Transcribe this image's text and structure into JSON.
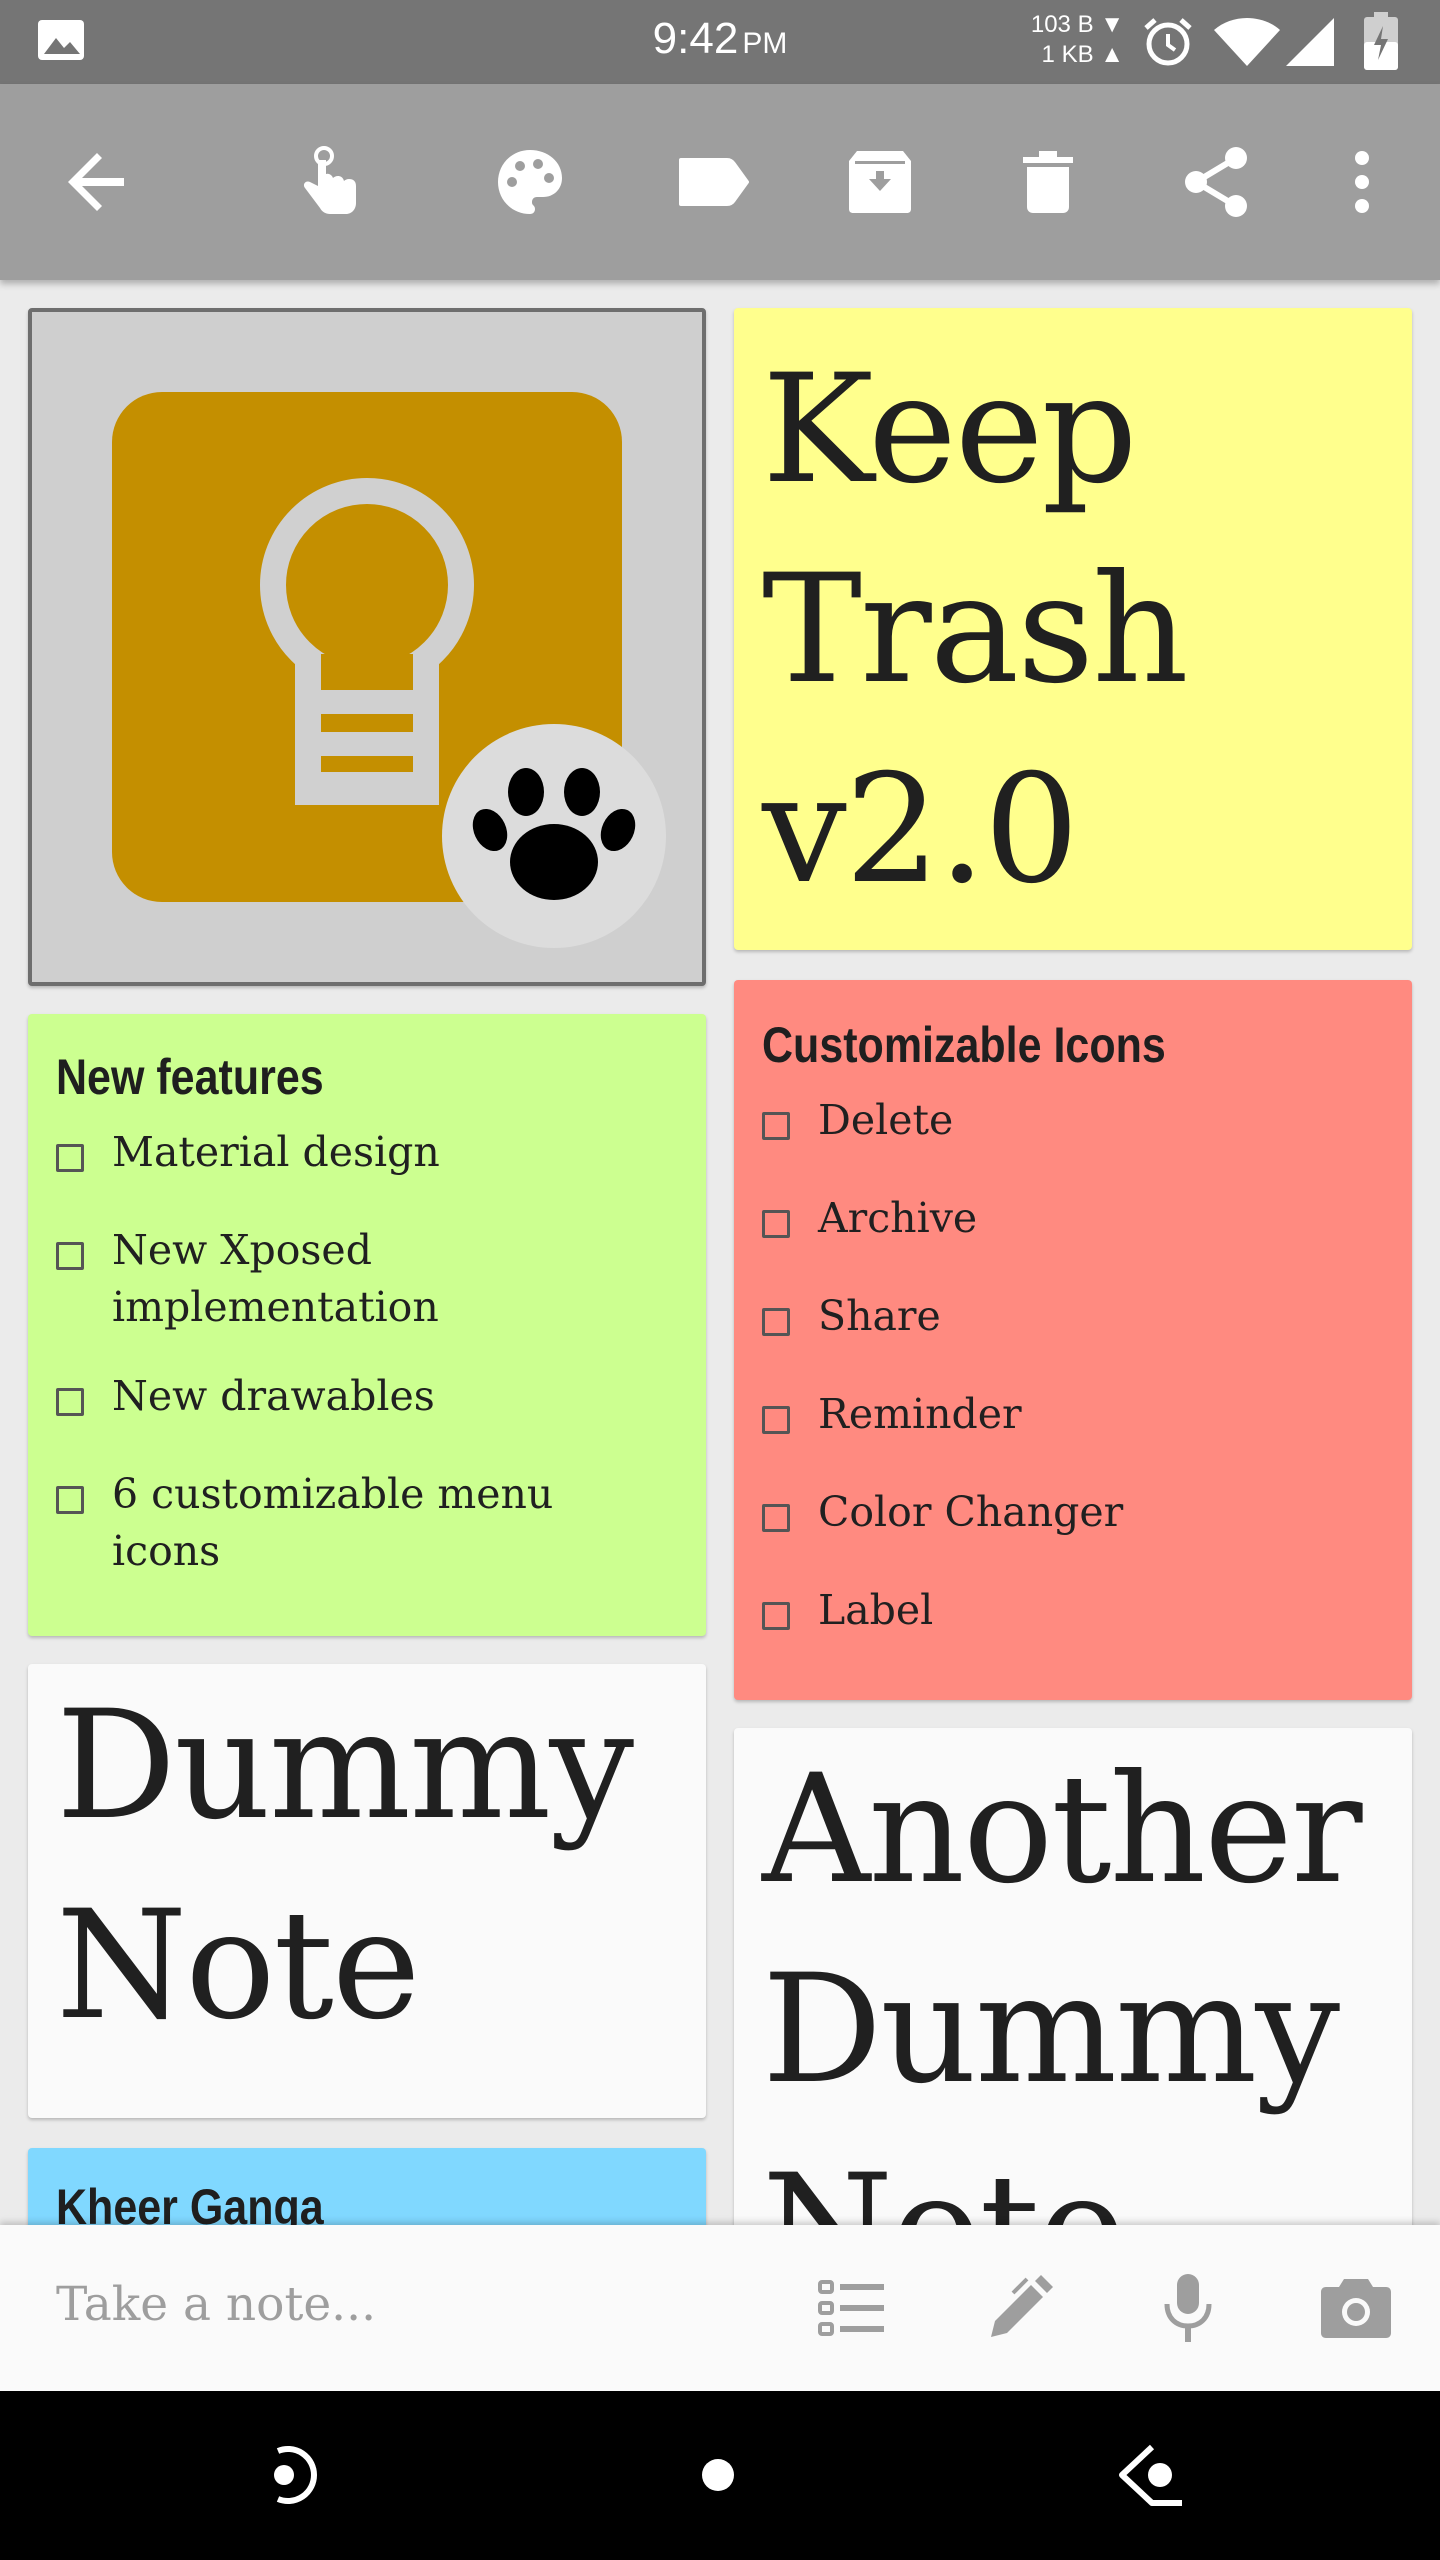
{
  "status_bar": {
    "time": "9:42",
    "ampm": "PM",
    "net_down": "103 B ▼",
    "net_up": "1 KB ▲",
    "icons": [
      "image-icon",
      "alarm-icon",
      "wifi-icon",
      "signal-icon",
      "battery-icon"
    ]
  },
  "toolbar": {
    "buttons": [
      "back-arrow-icon",
      "pin-icon",
      "palette-icon",
      "label-icon",
      "archive-icon",
      "delete-icon",
      "share-icon",
      "more-vert-icon"
    ]
  },
  "notes": {
    "image_note": {
      "icon": "keep-lightbulb-logo",
      "badge": "paw-icon"
    },
    "keep_trash": {
      "lines": [
        "Keep",
        "Trash",
        "v2.0"
      ]
    },
    "new_features": {
      "title": "New features",
      "items": [
        [
          "Material design"
        ],
        [
          "New Xposed",
          "implementation"
        ],
        [
          "New drawables"
        ],
        [
          "6 customizable menu",
          "icons"
        ]
      ]
    },
    "custom_icons": {
      "title": "Customizable Icons",
      "items": [
        "Delete",
        "Archive",
        "Share",
        "Reminder",
        "Color Changer",
        "Label"
      ]
    },
    "dummy_note": {
      "lines": [
        "Dummy",
        "Note"
      ]
    },
    "another_dummy": {
      "lines": [
        "Another",
        "Dummy",
        "Note"
      ]
    },
    "kheer": {
      "title": "Kheer Ganga"
    }
  },
  "bottom_bar": {
    "placeholder": "Take a note...",
    "icons": [
      "list-icon",
      "pen-icon",
      "mic-icon",
      "camera-icon"
    ]
  },
  "nav_bar": {
    "icons": [
      "recents-icon",
      "home-icon",
      "back-icon"
    ]
  },
  "colors": {
    "status_bar": "#757575",
    "toolbar": "#9e9e9e",
    "yellow_note": "#ffff8d",
    "green_note": "#ccff90",
    "red_note": "#ff8a80",
    "white_note": "#fafafa",
    "blue_note": "#80d8ff",
    "logo_gold": "#c48f00"
  }
}
